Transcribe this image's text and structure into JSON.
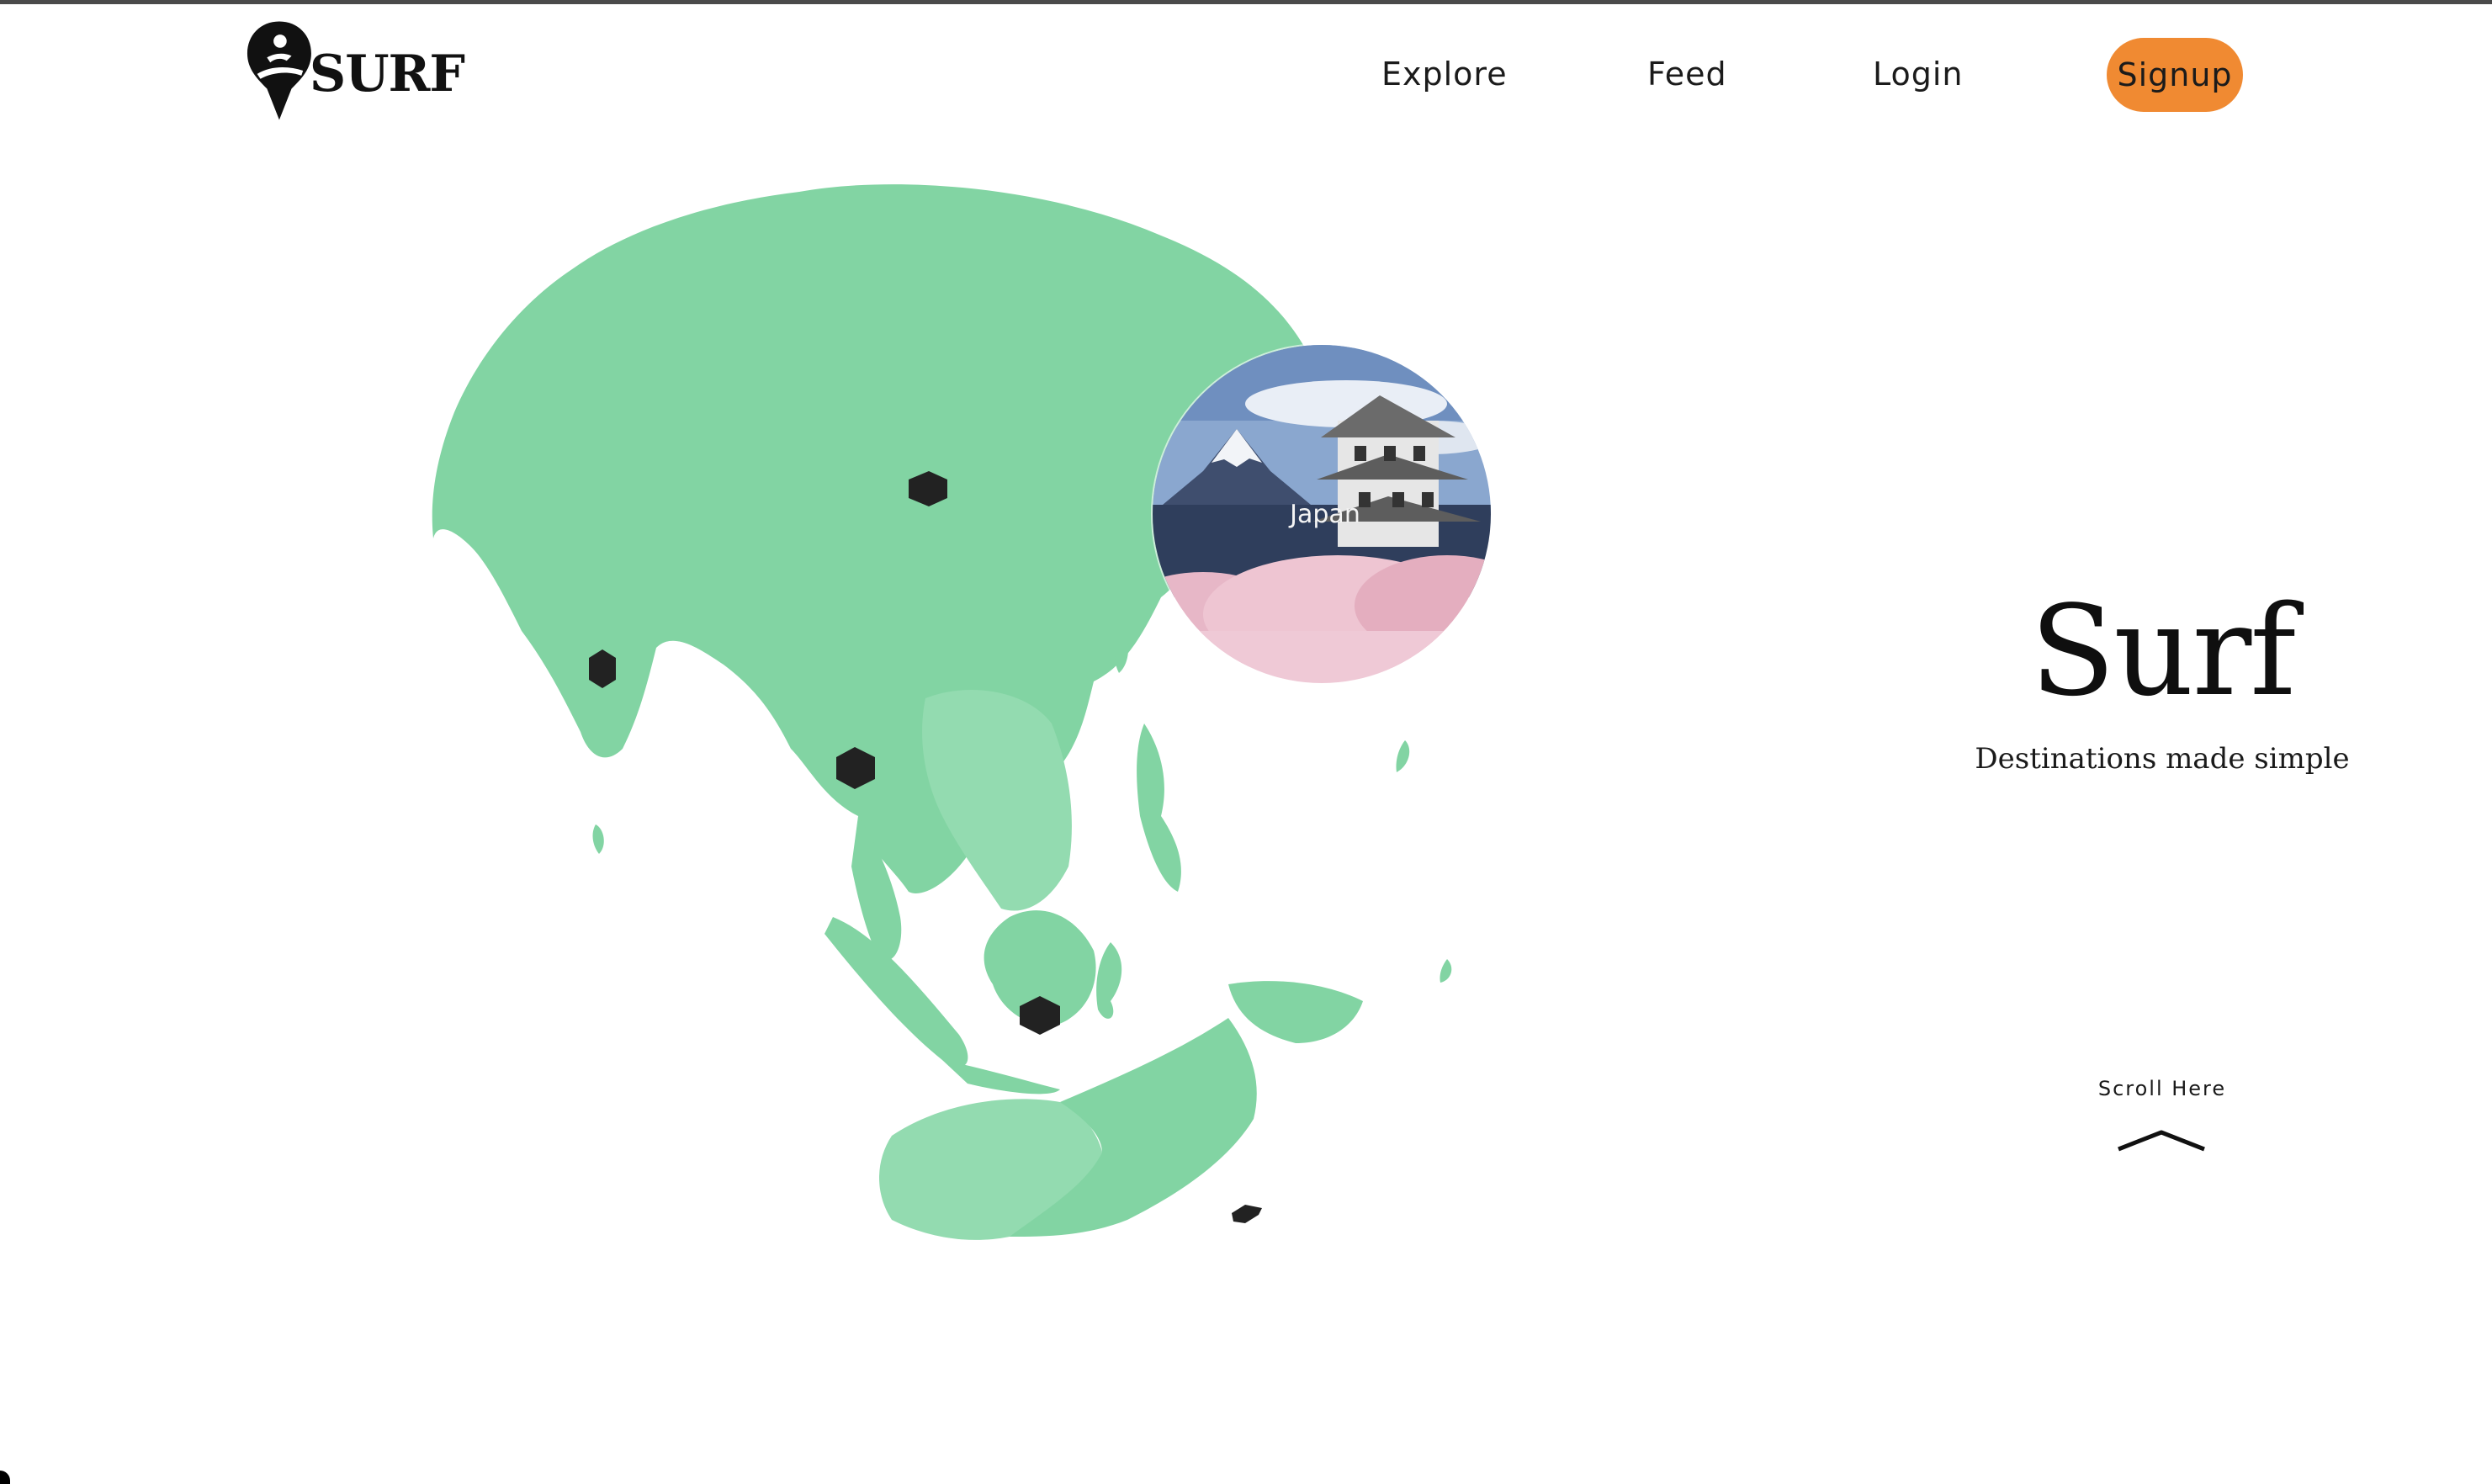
{
  "header": {
    "logo_text": "SURF",
    "logo_icon": "location-pin-surfer-icon",
    "nav": {
      "explore": "Explore",
      "feed": "Feed",
      "login": "Login",
      "signup": "Signup"
    }
  },
  "globe": {
    "land_color": "#82d4a3",
    "marker_color": "#222222",
    "featured_destination": {
      "label": "Japan",
      "image": "mount-fuji-castle-cherry-blossom-photo"
    }
  },
  "hero": {
    "title": "Surf",
    "subtitle": "Destinations made simple"
  },
  "scroll": {
    "text": "Scroll Here",
    "icon": "chevron-up-icon"
  },
  "colors": {
    "accent": "#f08a32",
    "text": "#111111",
    "background": "#ffffff"
  }
}
